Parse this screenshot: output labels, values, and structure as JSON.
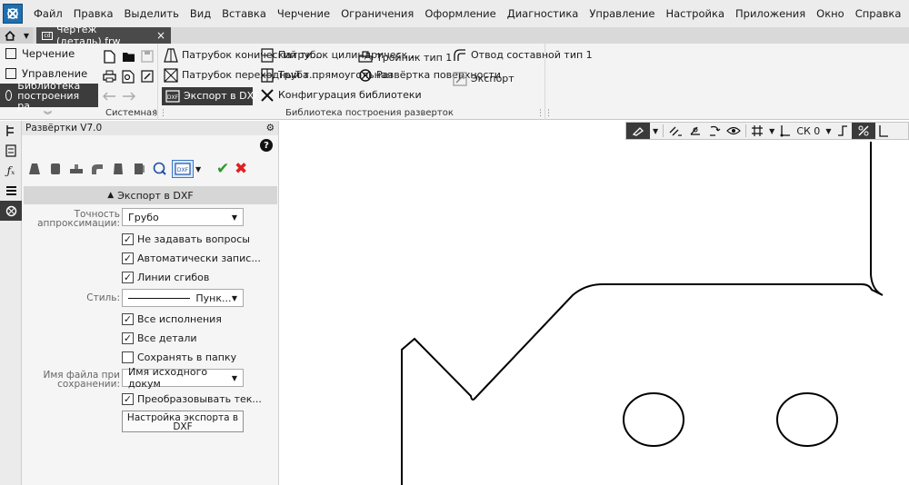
{
  "menu": {
    "items": [
      "Файл",
      "Правка",
      "Выделить",
      "Вид",
      "Вставка",
      "Черчение",
      "Ограничения",
      "Оформление",
      "Диагностика",
      "Управление",
      "Настройка",
      "Приложения",
      "Окно",
      "Справка"
    ]
  },
  "tabs": {
    "document": "Чертеж (деталь).frw",
    "close": "×"
  },
  "ribbon": {
    "left": {
      "items": [
        "Черчение",
        "Управление",
        "Библиотека построения ра..."
      ]
    },
    "system_group_label": "Системная",
    "library_group_label": "Библиотека построения разверток",
    "library_buttons": [
      "Патрубок конический ти...",
      "Патрубок цилиндрическ...",
      "Тройник тип 1",
      "Отвод составной тип 1",
      "Патрубок переходный т...",
      "Труба прямоугольная",
      "Развёртка поверхности",
      "Экспорт",
      "Экспорт в DXF",
      "Конфигурация библиотеки"
    ]
  },
  "panel": {
    "title": "Развёртки V7.0",
    "help": "?",
    "section_title": "Экспорт в DXF",
    "precision_label": "Точность аппроксимации:",
    "precision_value": "Грубо",
    "check_no_questions": "Не задавать вопросы",
    "check_autosave": "Автоматически запис...",
    "check_bend_lines": "Линии сгибов",
    "style_label": "Стиль:",
    "style_value": "Пунк...",
    "check_all_versions": "Все исполнения",
    "check_all_parts": "Все детали",
    "check_save_folder": "Сохранять в папку",
    "filename_label": "Имя файла при сохранении:",
    "filename_value": "Имя исходного докум",
    "check_convert_text": "Преобразовывать тек...",
    "settings_button": "Настройка экспорта в DXF"
  },
  "canvas_toolbar": {
    "cs_value": "СК 0"
  }
}
